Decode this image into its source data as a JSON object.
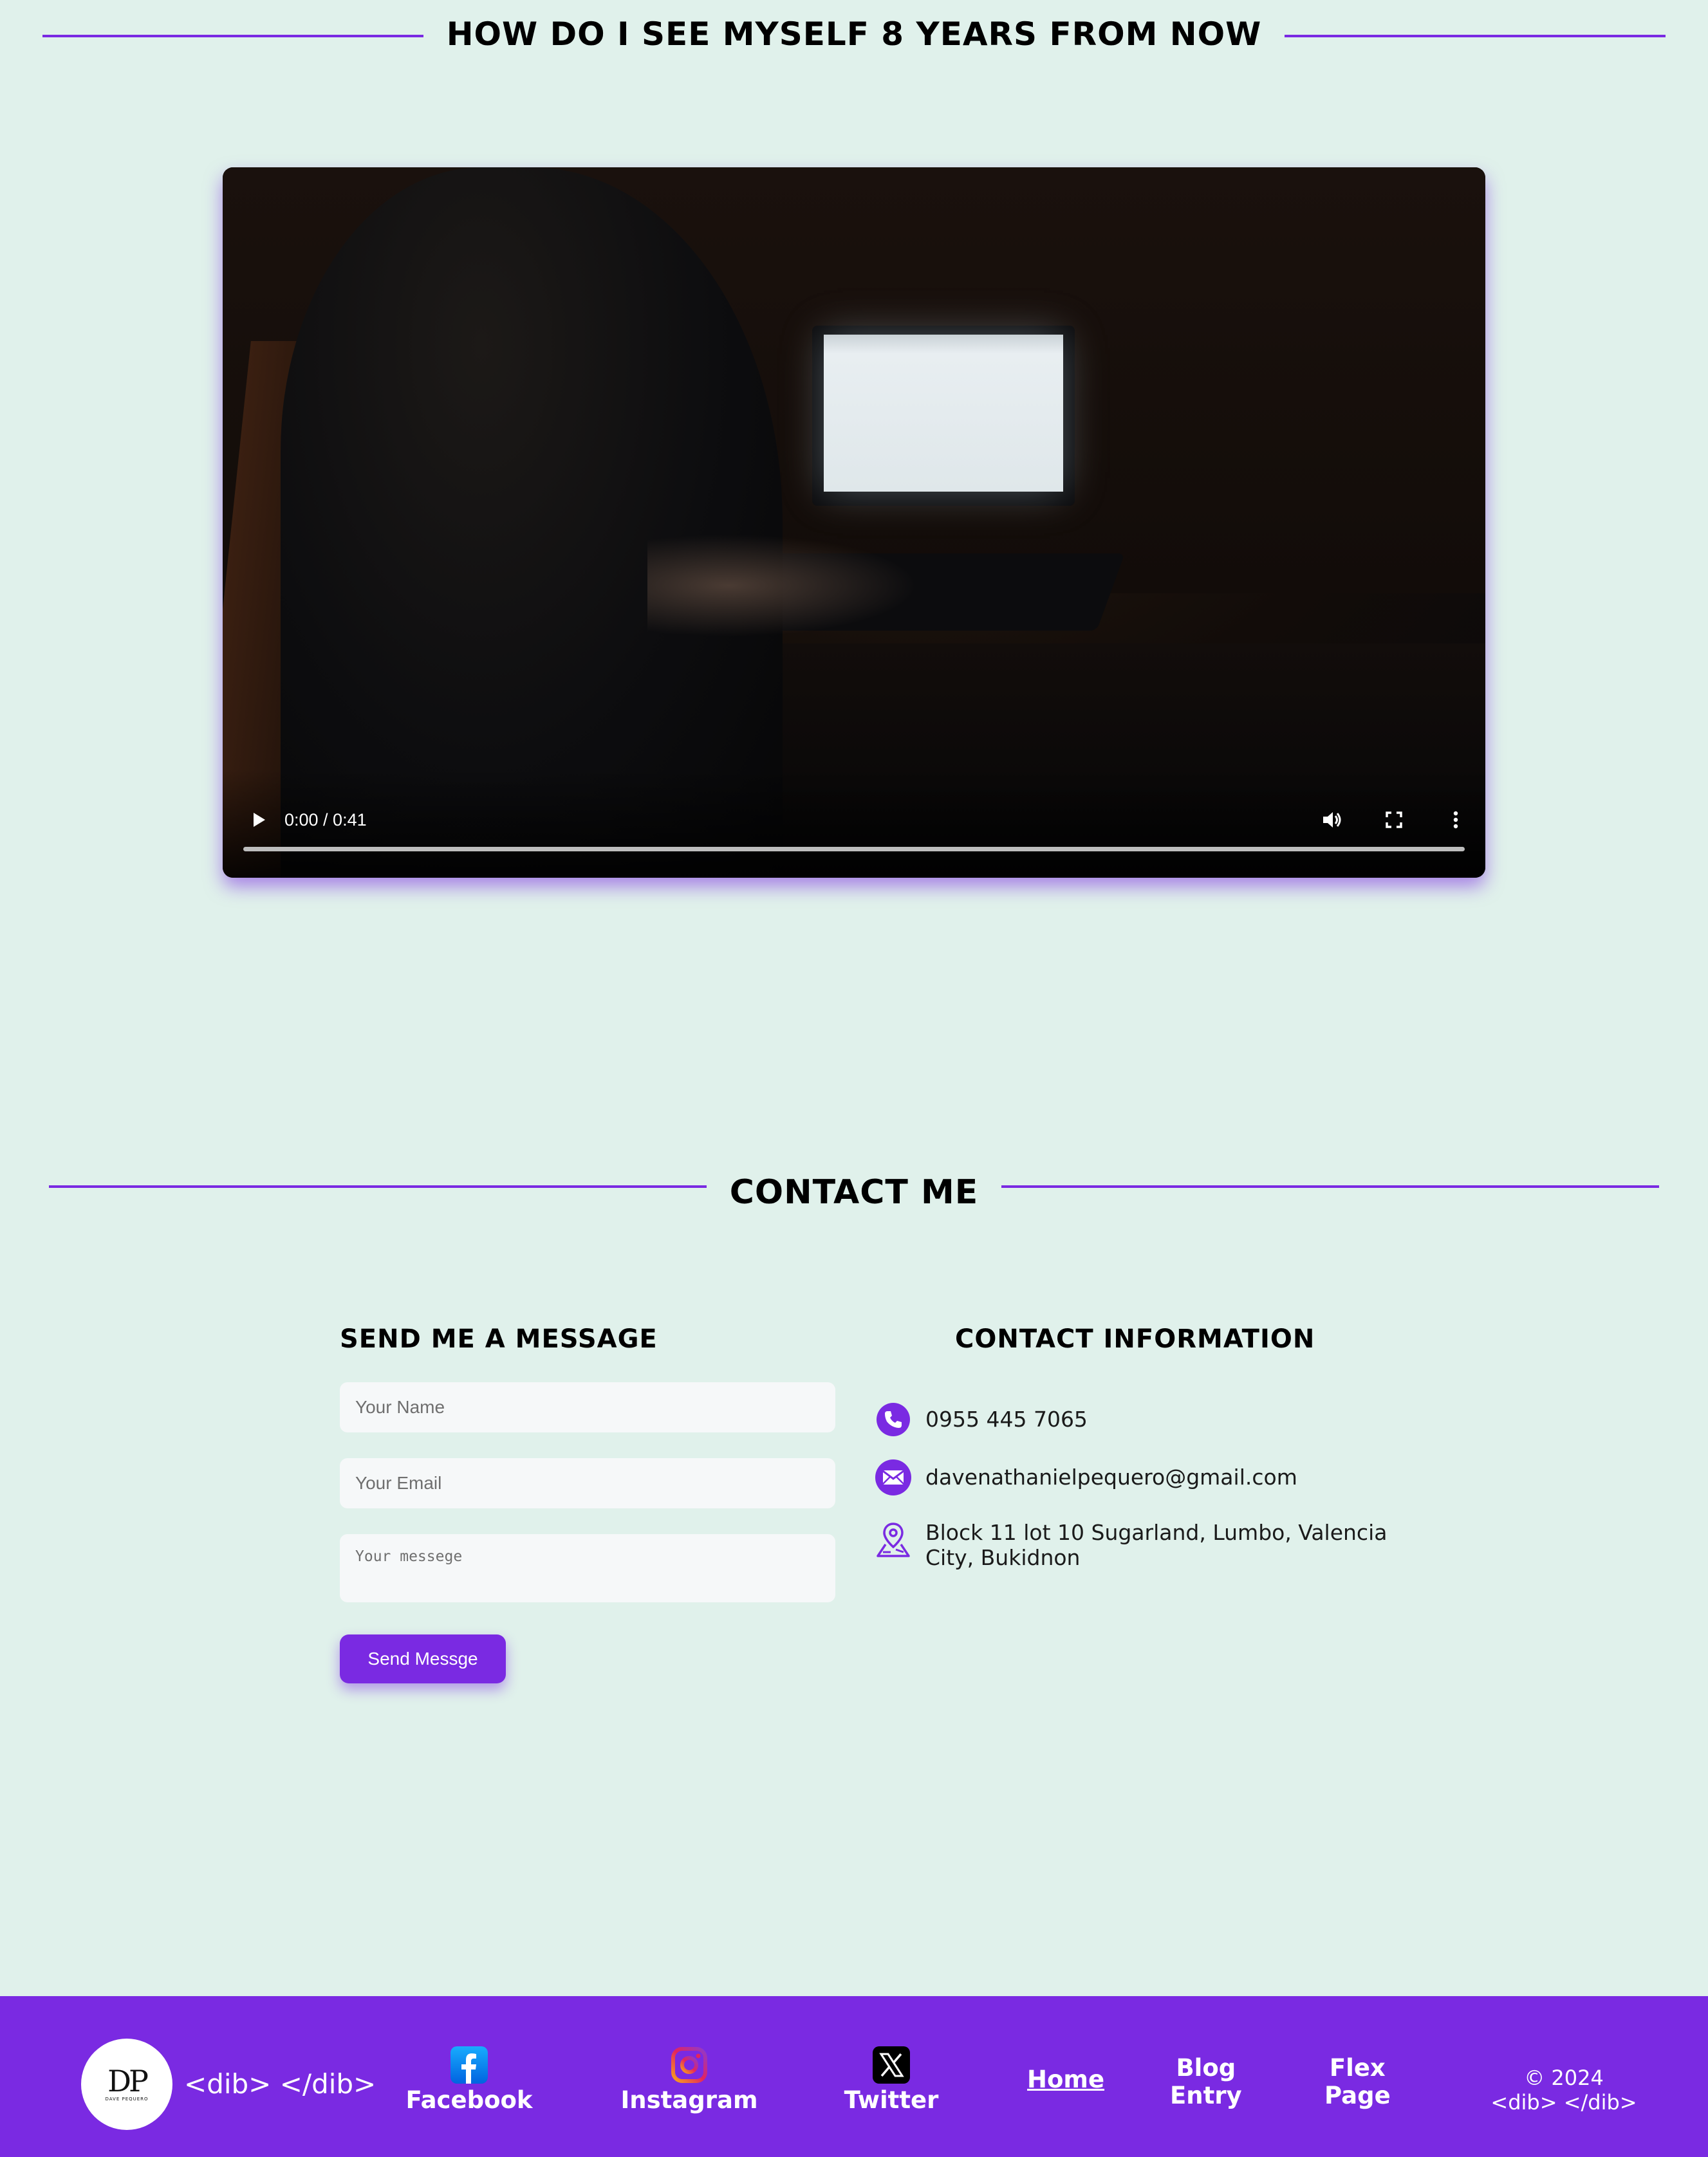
{
  "hero": {
    "title": "HOW DO I SEE MYSELF 8 YEARS FROM NOW"
  },
  "video": {
    "time": "0:00 / 0:41",
    "progress_fraction": 0,
    "icons": [
      "play-icon",
      "volume-icon",
      "fullscreen-icon",
      "more-options-icon"
    ]
  },
  "contact": {
    "title": "CONTACT ME",
    "form": {
      "title": "SEND ME A MESSAGE",
      "name_placeholder": "Your Name",
      "email_placeholder": "Your Email",
      "message_placeholder": "Your messege",
      "submit_label": "Send Messge"
    },
    "info": {
      "title": "CONTACT INFORMATION",
      "phone": "0955 445 7065",
      "email": "davenathanielpequero@gmail.com",
      "address": "Block 11 lot 10 Sugarland, Lumbo, Valencia City, Bukidnon"
    }
  },
  "footer": {
    "logo_text": "DP",
    "logo_subtext": "DAVE PEQUERO",
    "brand": "<dib> </dib>",
    "social": [
      {
        "label": "Facebook",
        "icon": "facebook-icon"
      },
      {
        "label": "Instagram",
        "icon": "instagram-icon"
      },
      {
        "label": "Twitter",
        "icon": "x-twitter-icon"
      }
    ],
    "nav": {
      "home": "Home",
      "blog_line1": "Blog",
      "blog_line2": "Entry",
      "flex_line1": "Flex",
      "flex_line2": "Page"
    },
    "copyright_line1": "© 2024",
    "copyright_line2": "<dib> </dib>"
  },
  "colors": {
    "background": "#e0f1eb",
    "accent": "#7a2ae2",
    "field_bg": "#f6f8f9"
  }
}
